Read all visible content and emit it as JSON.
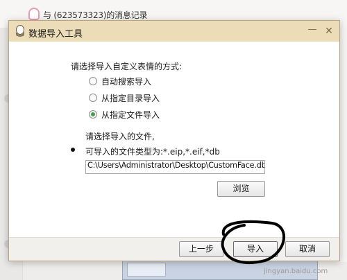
{
  "background": {
    "chat_title": "与                (623573323)的消息记录",
    "watermark": "jingyan.baidu.com"
  },
  "dialog": {
    "title": "数据导入工具",
    "prompt": "请选择导入自定义表情的方式:",
    "options": [
      {
        "label": "自动搜索导入",
        "checked": false
      },
      {
        "label": "从指定目录导入",
        "checked": false
      },
      {
        "label": "从指定文件导入",
        "checked": true
      }
    ],
    "file_prompt": "请选择导入的文件,",
    "file_types": "可导入的文件类型为:*.eip,*.eif,*db",
    "file_path": "C:\\Users\\Administrator\\Desktop\\CustomFace.db",
    "browse_label": "浏览",
    "buttons": {
      "prev": "上一步",
      "import": "导入",
      "cancel": "取消"
    },
    "window_controls": {
      "minimize": "—",
      "close": "✕"
    }
  },
  "colors": {
    "titlebar": "#ecdcb8",
    "radio_checked": "#3fa14a",
    "annotation": "#000000"
  }
}
